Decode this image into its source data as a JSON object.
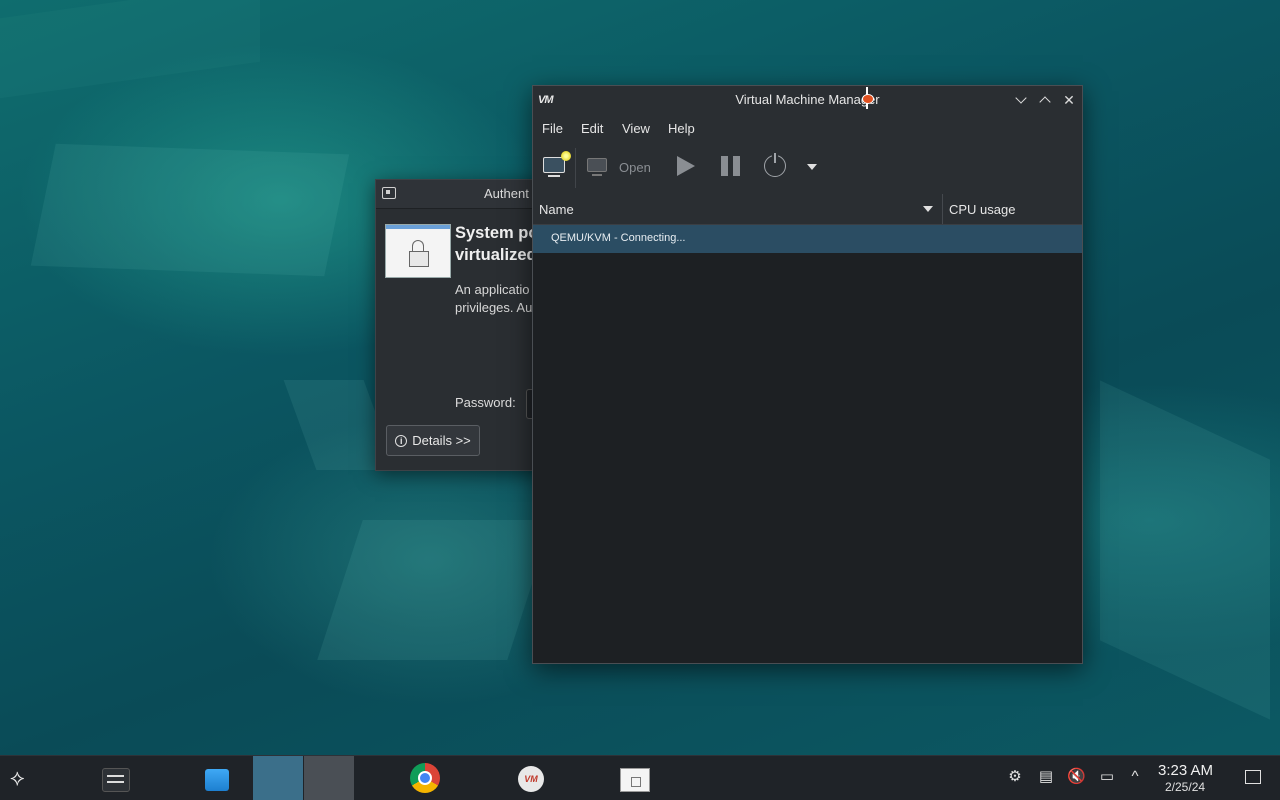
{
  "auth_dialog": {
    "title": "Authent",
    "heading_line1": "System po",
    "heading_line2": "virtualized",
    "body_line1": "An applicatio",
    "body_line2": "privileges. Au",
    "password_label": "Password:",
    "details_label": "Details >>"
  },
  "vmm": {
    "title": "Virtual Machine Manager",
    "logo": "VM",
    "menus": [
      "File",
      "Edit",
      "View",
      "Help"
    ],
    "toolbar": {
      "open_label": "Open"
    },
    "columns": {
      "name": "Name",
      "cpu": "CPU usage"
    },
    "rows": [
      {
        "label": "QEMU/KVM - Connecting..."
      }
    ]
  },
  "taskbar": {
    "vmm_icon_text": "VM",
    "clock": {
      "time": "3:23 AM",
      "date": "2/25/24"
    }
  },
  "colors": {
    "accent": "#3b6f8a",
    "selected_row": "#2b4d63"
  }
}
